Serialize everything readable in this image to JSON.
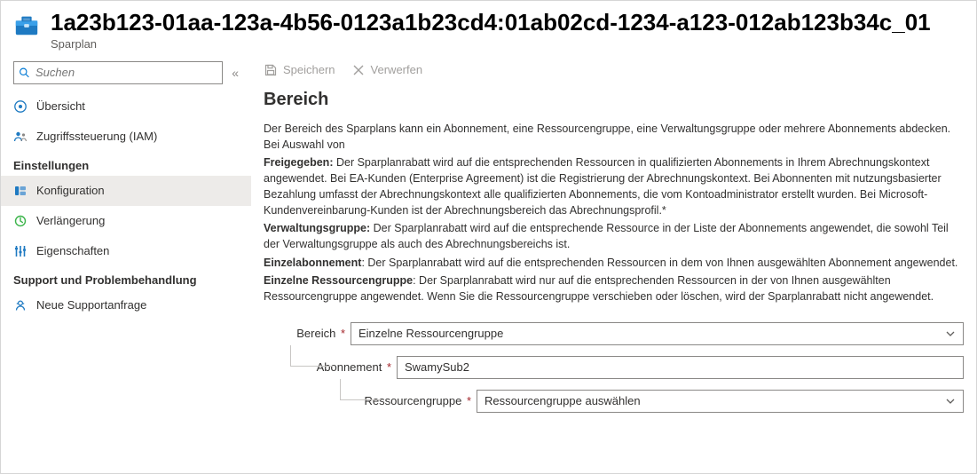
{
  "header": {
    "title": "1a23b123-01aa-123a-4b56-0123a1b23cd4:01ab02cd-1234-a123-012ab123b34c_01",
    "subtitle": "Sparplan"
  },
  "search": {
    "placeholder": "Suchen"
  },
  "nav": {
    "top": [
      {
        "label": "Übersicht"
      },
      {
        "label": "Zugriffssteuerung (IAM)"
      }
    ],
    "group_settings": "Einstellungen",
    "settings": [
      {
        "label": "Konfiguration"
      },
      {
        "label": "Verlängerung"
      },
      {
        "label": "Eigenschaften"
      }
    ],
    "group_support": "Support und Problembehandlung",
    "support": [
      {
        "label": "Neue Supportanfrage"
      }
    ]
  },
  "commands": {
    "save": "Speichern",
    "discard": "Verwerfen"
  },
  "section": {
    "title": "Bereich",
    "intro": "Der Bereich des Sparplans kann ein Abonnement, eine Ressourcengruppe, eine Verwaltungsgruppe oder mehrere Abonnements abdecken. Bei Auswahl von",
    "shared_label": "Freigegeben:",
    "shared_text": " Der Sparplanrabatt wird auf die entsprechenden Ressourcen in qualifizierten Abonnements in Ihrem Abrechnungskontext angewendet. Bei EA-Kunden (Enterprise Agreement) ist die Registrierung der Abrechnungskontext. Bei Abonnenten mit nutzungsbasierter Bezahlung umfasst der Abrechnungskontext alle qualifizierten Abonnements, die vom Kontoadministrator erstellt wurden. Bei Microsoft-Kundenvereinbarung-Kunden ist der Abrechnungsbereich das Abrechnungsprofil.*",
    "mg_label": "Verwaltungsgruppe:",
    "mg_text": " Der Sparplanrabatt wird auf die entsprechende Ressource in der Liste der Abonnements angewendet, die sowohl Teil der Verwaltungsgruppe als auch des Abrechnungsbereichs ist.",
    "single_sub_label": "Einzelabonnement",
    "single_sub_text": ": Der Sparplanrabatt wird auf die entsprechenden Ressourcen in dem von Ihnen ausgewählten Abonnement angewendet.",
    "single_rg_label": "Einzelne Ressourcengruppe",
    "single_rg_text": ": Der Sparplanrabatt wird nur auf die entsprechenden Ressourcen in der von Ihnen ausgewählten Ressourcengruppe angewendet. Wenn Sie die Ressourcengruppe verschieben oder löschen, wird der Sparplanrabatt nicht angewendet."
  },
  "form": {
    "scope_label": "Bereich",
    "scope_value": "Einzelne Ressourcengruppe",
    "subscription_label": "Abonnement",
    "subscription_value": "SwamySub2",
    "rg_label": "Ressourcengruppe",
    "rg_value": "Ressourcengruppe auswählen"
  }
}
